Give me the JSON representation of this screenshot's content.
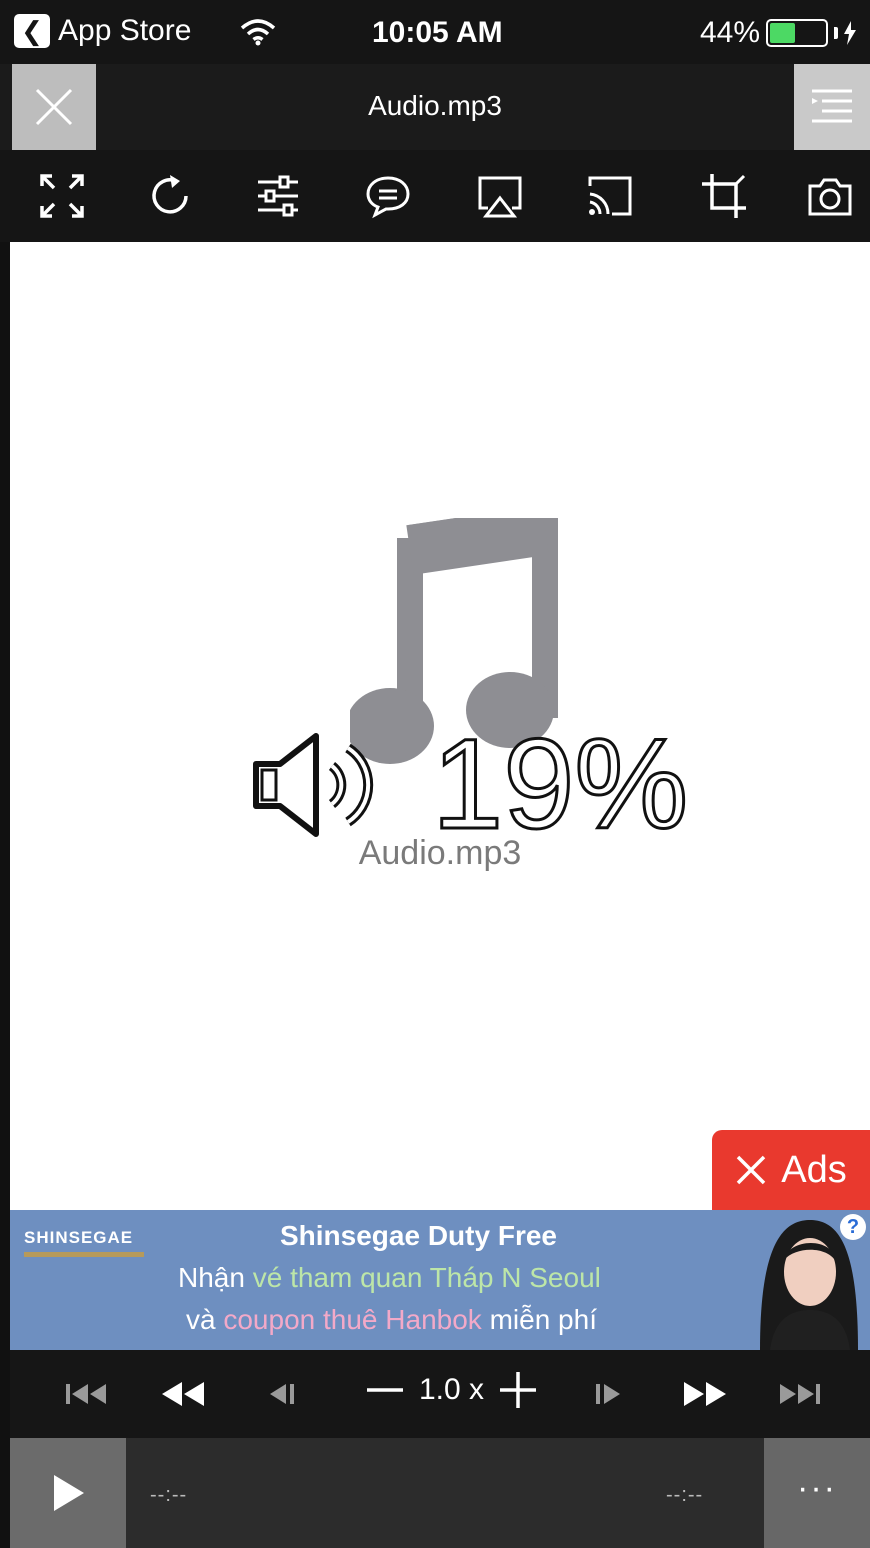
{
  "status_bar": {
    "back_label": "App Store",
    "time": "10:05 AM",
    "battery_pct": "44%",
    "battery_level": 0.44
  },
  "titlebar": {
    "title": "Audio.mp3"
  },
  "toolbar": {
    "icons": [
      "fullscreen-icon",
      "rotate-icon",
      "equalizer-icon",
      "subtitle-icon",
      "airplay-icon",
      "cast-icon",
      "crop-icon",
      "camera-icon"
    ]
  },
  "player": {
    "volume_text": "19%",
    "volume_level": 0.19,
    "file_name": "Audio.mp3"
  },
  "ads_button": {
    "label": "Ads"
  },
  "banner": {
    "brand": "SHINSEGAE",
    "headline": "Shinsegae Duty Free",
    "line2_a": "Nhận",
    "line2_b": "vé tham quan Tháp N Seoul",
    "line3_a": "và",
    "line3_b": "coupon thuê Hanbok",
    "line3_c": "miễn phí",
    "help_label": "?"
  },
  "transport": {
    "speed": "1.0 x"
  },
  "bottom_bar": {
    "elapsed": "--:--",
    "remaining": "--:--",
    "more_label": "···"
  },
  "colors": {
    "ads_red": "#e9392e",
    "battery_green": "#4cd964",
    "banner_blue": "#6e8fc0"
  }
}
